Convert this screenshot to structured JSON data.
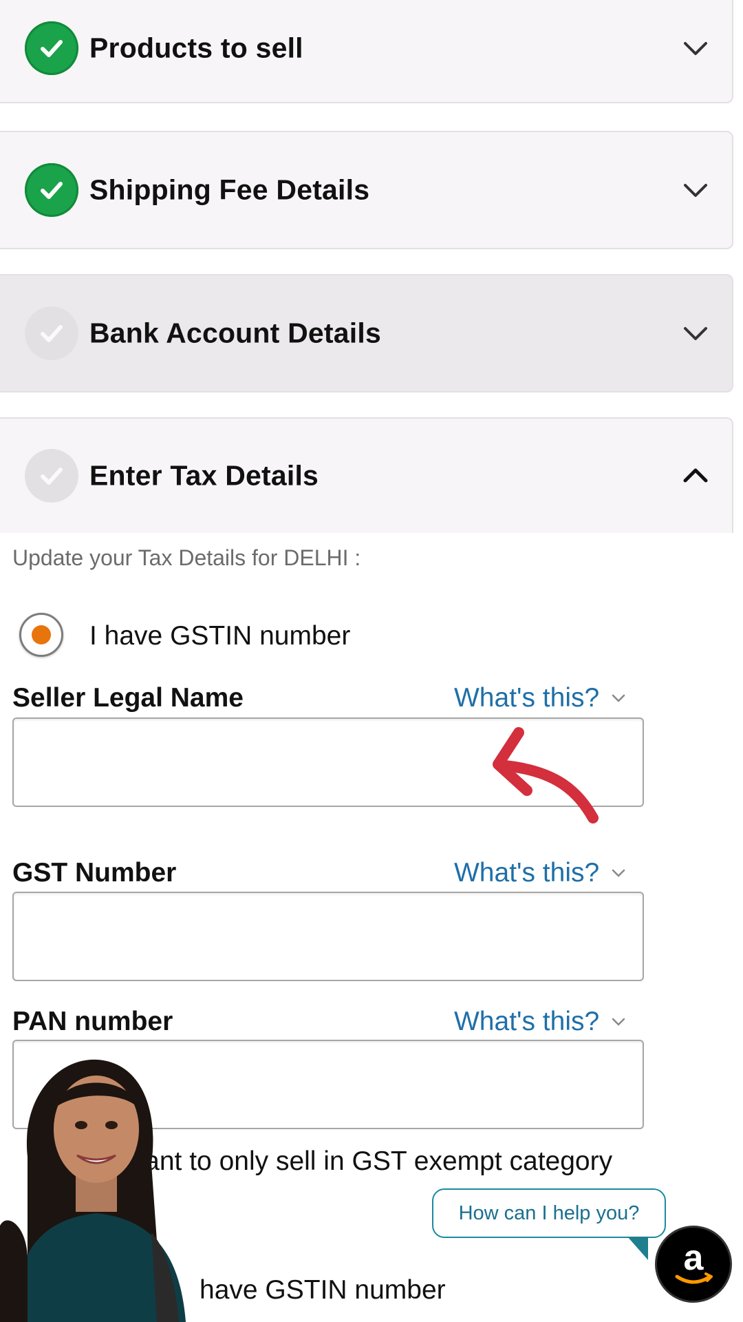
{
  "sections": [
    {
      "title": "Products to sell",
      "status": "complete"
    },
    {
      "title": "Shipping Fee Details",
      "status": "complete"
    },
    {
      "title": "Bank Account Details",
      "status": "pending"
    },
    {
      "title": "Enter Tax Details",
      "status": "pending",
      "expanded": true
    }
  ],
  "tax": {
    "subtitle": "Update your Tax Details for DELHI :",
    "gstin_option": "I have GSTIN number",
    "fields": [
      {
        "label": "Seller Legal Name",
        "help": "What's this?",
        "value": ""
      },
      {
        "label": "GST Number",
        "help": "What's this?",
        "value": ""
      },
      {
        "label": "PAN number",
        "help": "What's this?",
        "value": ""
      }
    ],
    "exempt_option": "want to only sell in GST exempt category",
    "no_gstin_option": "have GSTIN number"
  },
  "chat": {
    "prompt": "How can I help you?"
  },
  "colors": {
    "complete_green": "#1aa34a",
    "link_blue": "#1f6fa8",
    "radio_orange": "#e8740c",
    "annotation_red": "#d32f3c"
  },
  "icons": {
    "complete": "check-circle-icon",
    "pending": "check-circle-outline-icon",
    "collapsed": "chevron-down-icon",
    "expanded": "chevron-up-icon",
    "chat_badge": "amazon-logo-icon"
  }
}
